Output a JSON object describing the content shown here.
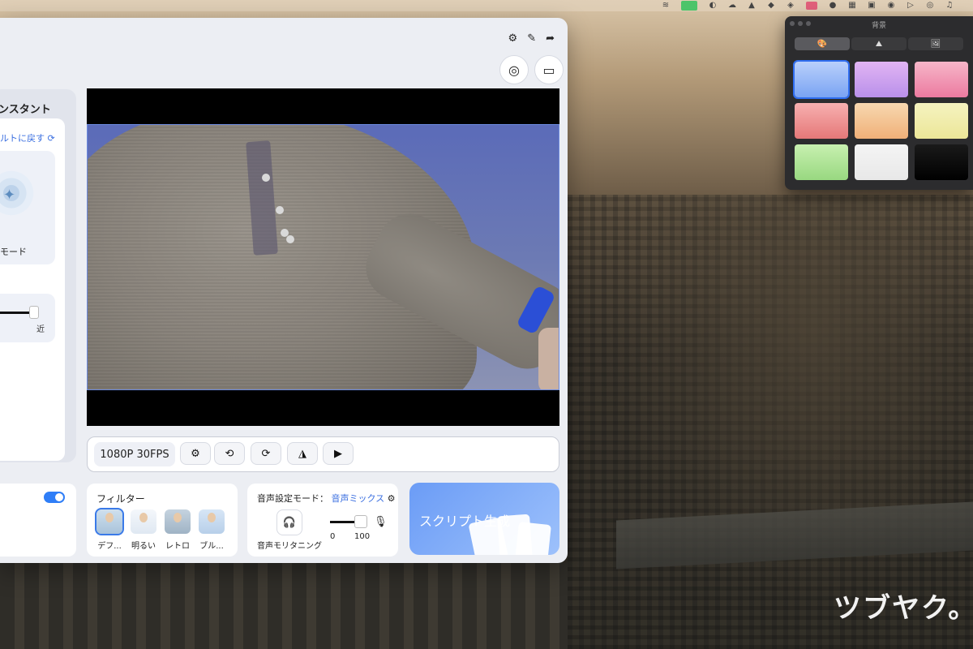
{
  "assistant": {
    "title": "ンスタント",
    "reset_label": "ルトに戻す",
    "mode_label": "モード",
    "slider_end_label": "近"
  },
  "toolbar": {
    "settings_icon": "⚙",
    "pin_icon": "✎",
    "share_icon": "➦"
  },
  "controls": {
    "resolution": "1080P 30FPS",
    "buttons": [
      {
        "name": "camera-settings-button",
        "icon": "⚙"
      },
      {
        "name": "rotate-left-button",
        "icon": "⟲"
      },
      {
        "name": "rotate-right-button",
        "icon": "⟳"
      },
      {
        "name": "mirror-button",
        "icon": "◮"
      },
      {
        "name": "flip-button",
        "icon": "▶"
      }
    ]
  },
  "filters": {
    "title": "フィルター",
    "items": [
      {
        "label": "デフ...",
        "selected": true
      },
      {
        "label": "明るい",
        "selected": false
      },
      {
        "label": "レトロ",
        "selected": false
      },
      {
        "label": "ブル...",
        "selected": false
      }
    ]
  },
  "audio": {
    "mode_label": "音声設定モード：",
    "mode_value": "音声ミックス",
    "monitoring_label": "音声モリタニング",
    "volume_min": "0",
    "volume_max": "100"
  },
  "script_card": {
    "label": "スクリプト生成"
  },
  "background_panel": {
    "title": "背景",
    "tabs": [
      "🎨",
      "⛰",
      "🖼"
    ],
    "swatches": [
      {
        "color_top": "#b9d0fb",
        "color_bottom": "#7aa4f3",
        "selected": true
      },
      {
        "color_top": "#e1b4f3",
        "color_bottom": "#b990ea",
        "selected": false
      },
      {
        "color_top": "#f6b6c8",
        "color_bottom": "#ec7aa0",
        "selected": false
      },
      {
        "color_top": "#f7b0b0",
        "color_bottom": "#e57878",
        "selected": false
      },
      {
        "color_top": "#f7d8b0",
        "color_bottom": "#f0b078",
        "selected": false
      },
      {
        "color_top": "#f5f3c0",
        "color_bottom": "#ece698",
        "selected": false
      },
      {
        "color_top": "#c8f0b0",
        "color_bottom": "#98d880",
        "selected": false
      },
      {
        "color_top": "#f4f4f4",
        "color_bottom": "#e8e8e8",
        "selected": false
      },
      {
        "color_top": "#1a1a1a",
        "color_bottom": "#000000",
        "selected": false
      }
    ]
  },
  "watermark": "ツブヤク。",
  "colors": {
    "accent": "#2f7ef7",
    "link": "#3b6fe0"
  }
}
